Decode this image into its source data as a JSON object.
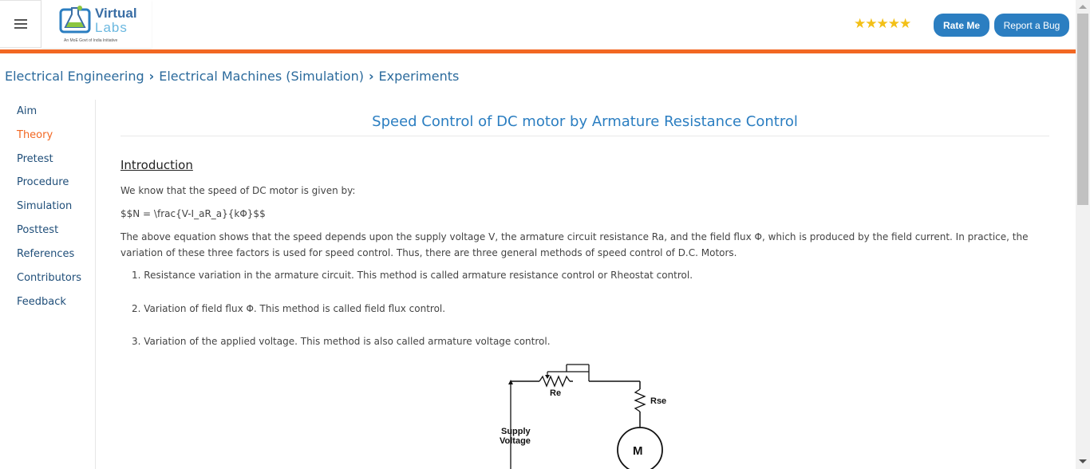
{
  "header": {
    "logo": {
      "line1": "Virtual",
      "line2": "Labs",
      "tagline": "An MoE Govt of India Initiative"
    },
    "rating_stars": "★★★★★",
    "rate_button": "Rate Me",
    "bug_button": "Report a Bug",
    "accent_color": "#f26722",
    "button_color": "#2b7ec1"
  },
  "breadcrumb": {
    "items": [
      "Electrical Engineering",
      "Electrical Machines (Simulation)",
      "Experiments"
    ],
    "separator": "›"
  },
  "sidebar": {
    "items": [
      {
        "label": "Aim"
      },
      {
        "label": "Theory"
      },
      {
        "label": "Pretest"
      },
      {
        "label": "Procedure"
      },
      {
        "label": "Simulation"
      },
      {
        "label": "Posttest"
      },
      {
        "label": "References"
      },
      {
        "label": "Contributors"
      },
      {
        "label": "Feedback"
      }
    ],
    "active": "Theory"
  },
  "main": {
    "title": "Speed Control of DC motor by Armature Resistance Control",
    "heading": "Introduction",
    "para1": "We know that the speed of DC motor is given by:",
    "para2": "$$N = \\frac{V-I_aR_a}{kΦ}$$",
    "para3": "The above equation shows that the speed depends upon the supply voltage V, the armature circuit resistance Ra, and the field flux Φ, which is produced by the field current. In practice, the variation of these three factors is used for speed control. Thus, there are three general methods of speed control of D.C. Motors.",
    "list": [
      "1. Resistance variation in the armature circuit. This method is called armature resistance control or Rheostat control.",
      "2. Variation of field flux Φ. This method is called field flux control.",
      "3. Variation of the applied voltage. This method is also called armature voltage control."
    ],
    "diagram": {
      "re_label": "Re",
      "rse_label": "Rse",
      "supply_label_1": "Supply",
      "supply_label_2": "Voltage",
      "motor_label": "M"
    }
  }
}
